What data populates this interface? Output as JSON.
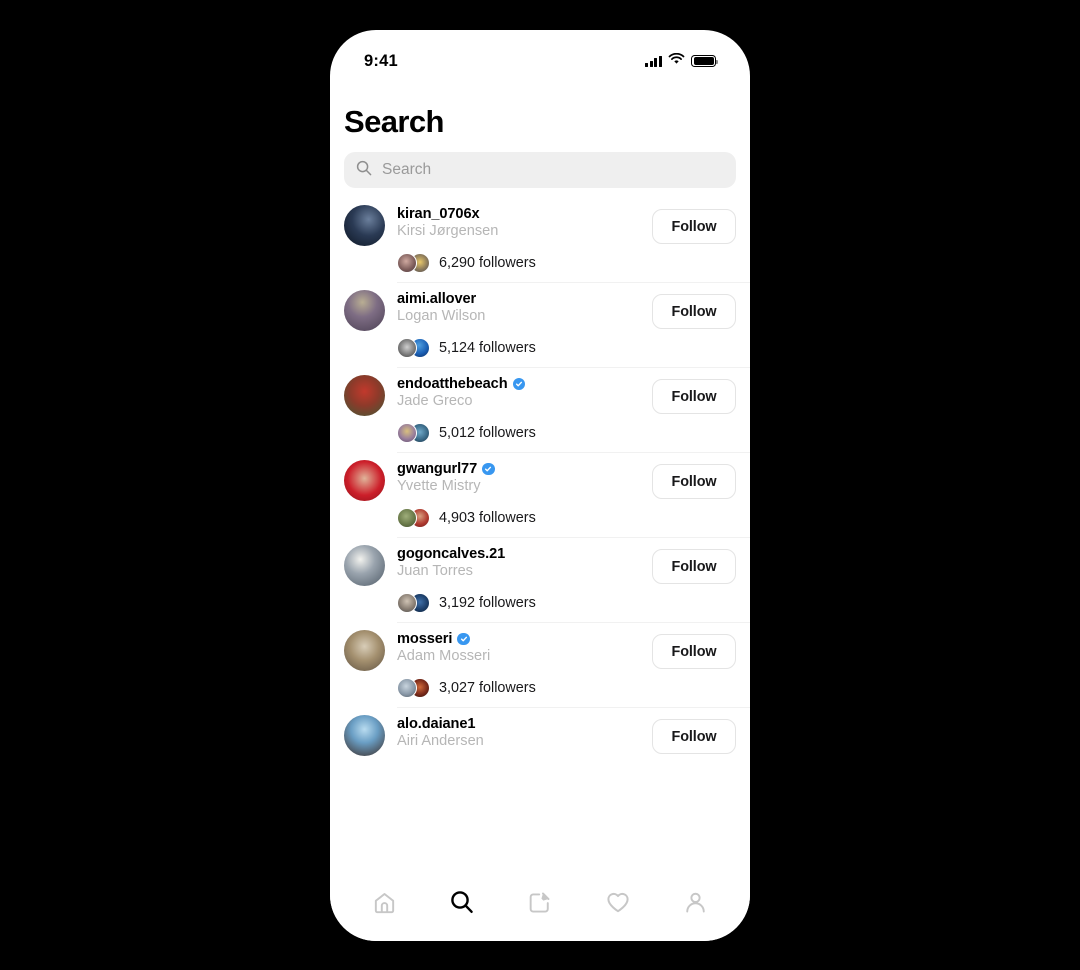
{
  "device": {
    "frame_color": "#000000",
    "screen_bg": "#ffffff"
  },
  "status_bar": {
    "time": "9:41",
    "cellular_icon": "cellular-bars-icon",
    "wifi_icon": "wifi-icon",
    "battery_icon": "battery-full-icon"
  },
  "header": {
    "title": "Search"
  },
  "search": {
    "icon": "search-icon",
    "placeholder": "Search",
    "value": "",
    "background": "#efefef"
  },
  "colors": {
    "verified_blue": "#3897f0",
    "secondary_text": "#b6b6b6",
    "primary_text": "#000000",
    "separator": "#f1f1f1",
    "button_border": "#e4e4e4"
  },
  "accounts": [
    {
      "username": "kiran_0706x",
      "full_name": "Kirsi Jørgensen",
      "verified": false,
      "followers_text": "6,290 followers",
      "follow_label": "Follow",
      "avatar_grad": "radial-gradient(circle at 60% 35%, #6b7f9c 0%, #2a3a54 45%, #0d1522 100%)",
      "mini_a": "radial-gradient(circle at 45% 40%, #cfa9a0 0%, #7a5a58 60%, #4a3a3f 100%)",
      "mini_b": "radial-gradient(circle at 50% 45%, #e8c86a 0%, #8c7a5a 55%, #4d4a52 100%)"
    },
    {
      "username": "aimi.allover",
      "full_name": "Logan Wilson",
      "verified": false,
      "followers_text": "5,124 followers",
      "follow_label": "Follow",
      "avatar_grad": "radial-gradient(circle at 45% 30%, #b9ae93 0%, #7e6d84 40%, #4a3f52 100%)",
      "mini_a": "radial-gradient(circle at 50% 45%, #cfcfcf 0%, #7d7d7d 55%, #3b3b3b 100%)",
      "mini_b": "radial-gradient(circle at 45% 35%, #4f9fe0 0%, #1a5fb4 55%, #0b2a5c 100%)"
    },
    {
      "username": "endoatthebeach",
      "full_name": "Jade Greco",
      "verified": true,
      "followers_text": "5,012 followers",
      "follow_label": "Follow",
      "avatar_grad": "radial-gradient(circle at 50% 40%, #c2392c 0%, #8d3a2a 45%, #3f5a35 100%)",
      "mini_a": "radial-gradient(circle at 50% 40%, #d9c07e 0%, #9a7f9c 55%, #5a4a6a 100%)",
      "mini_b": "radial-gradient(circle at 50% 45%, #6fa8c8 0%, #3a6a88 55%, #1d3344 100%)"
    },
    {
      "username": "gwangurl77",
      "full_name": "Yvette Mistry",
      "verified": true,
      "followers_text": "4,903 followers",
      "follow_label": "Follow",
      "avatar_grad": "radial-gradient(circle at 50% 45%, #e0b49a 0%, #cc1f2a 55%, #8c1018 100%)",
      "mini_a": "radial-gradient(circle at 45% 40%, #9fae7a 0%, #6a7a4a 55%, #3d4a2a 100%)",
      "mini_b": "radial-gradient(circle at 50% 40%, #d8a080 0%, #b03a30 55%, #6a1a18 100%)"
    },
    {
      "username": "gogoncalves.21",
      "full_name": "Juan Torres",
      "verified": false,
      "followers_text": "3,192 followers",
      "follow_label": "Follow",
      "avatar_grad": "radial-gradient(circle at 40% 35%, #f2f2ee 0%, #9aa4ae 40%, #4e5a66 100%)",
      "mini_a": "radial-gradient(circle at 50% 40%, #cfc3b4 0%, #8a7f74 55%, #4a4a4a 100%)",
      "mini_b": "radial-gradient(circle at 50% 45%, #3f6fa8 0%, #1d3f6a 55%, #0e2138 100%)"
    },
    {
      "username": "mosseri",
      "full_name": "Adam Mosseri",
      "verified": true,
      "followers_text": "3,027 followers",
      "follow_label": "Follow",
      "avatar_grad": "radial-gradient(circle at 50% 40%, #d8cdb8 0%, #a4906f 45%, #5e5140 100%)",
      "mini_a": "radial-gradient(circle at 45% 40%, #c8d4de 0%, #8a99a8 55%, #4a5560 100%)",
      "mini_b": "radial-gradient(circle at 50% 45%, #d06a3a 0%, #7a2a1a 55%, #2a1008 100%)"
    },
    {
      "username": "alo.daiane1",
      "full_name": "Airi Andersen",
      "verified": false,
      "followers_text": "",
      "follow_label": "Follow",
      "avatar_grad": "radial-gradient(circle at 50% 35%, #b9dcf0 0%, #6a9ec4 40%, #3a2a24 100%)",
      "mini_a": "",
      "mini_b": ""
    }
  ],
  "tabbar": {
    "items": [
      {
        "name": "home-icon",
        "label": "Home",
        "active": false
      },
      {
        "name": "search-icon",
        "label": "Search",
        "active": true
      },
      {
        "name": "compose-icon",
        "label": "Create",
        "active": false
      },
      {
        "name": "heart-icon",
        "label": "Activity",
        "active": false
      },
      {
        "name": "profile-icon",
        "label": "Profile",
        "active": false
      }
    ]
  }
}
